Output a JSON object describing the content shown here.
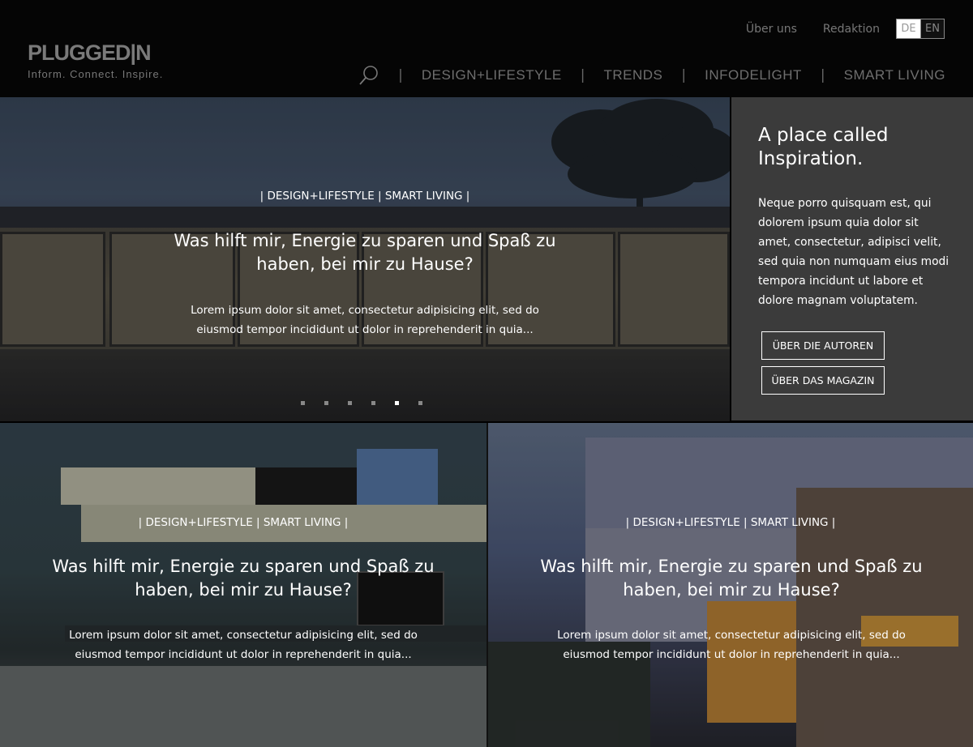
{
  "brand": {
    "logo": "PLUGGED|N",
    "tagline": "Inform. Connect. Inspire."
  },
  "topnav": {
    "about": "Über uns",
    "redaktion": "Redaktion",
    "lang_de": "DE",
    "lang_en": "EN"
  },
  "mainnav": {
    "items": [
      "DESIGN+LIFESTYLE",
      "TRENDS",
      "INFODELIGHT",
      "SMART LIVING"
    ],
    "separator": "|"
  },
  "hero": {
    "categories": "|  DESIGN+LIFESTYLE  |  SMART LIVING  |",
    "title": "Was hilft mir, Energie zu sparen und Spaß zu haben, bei mir zu Hause?",
    "excerpt": "Lorem ipsum dolor sit amet, consectetur adipisicing elit, sed do eiusmod tempor incididunt ut  dolor in reprehenderit in quia...",
    "slide_count": 6,
    "active_slide": 5
  },
  "side_panel": {
    "heading": "A place called Inspiration.",
    "text": "Neque porro quisquam est, qui dolorem ipsum quia dolor sit amet, consectetur, adipisci velit, sed quia non numquam eius modi tempora incidunt ut labore et dolore magnam voluptatem.",
    "button_authors": "ÜBER DIE AUTOREN",
    "button_magazine": "ÜBER DAS MAGAZIN",
    "background": "#3b3b3b"
  },
  "cards": [
    {
      "categories": "|  DESIGN+LIFESTYLE  |  SMART LIVING  |",
      "title": "Was hilft mir, Energie zu sparen und Spaß zu haben, bei mir zu Hause?",
      "excerpt": "Lorem ipsum dolor sit amet, consectetur adipisicing elit, sed do eiusmod tempor incididunt ut  dolor in reprehenderit in quia..."
    },
    {
      "categories": "|  DESIGN+LIFESTYLE  |  SMART LIVING  |",
      "title": "Was hilft mir, Energie zu sparen und Spaß zu haben, bei mir zu Hause?",
      "excerpt": "Lorem ipsum dolor sit amet, consectetur adipisicing elit, sed do eiusmod tempor incididunt ut  dolor in reprehenderit in quia..."
    }
  ],
  "icons": {
    "search": "search-icon"
  }
}
